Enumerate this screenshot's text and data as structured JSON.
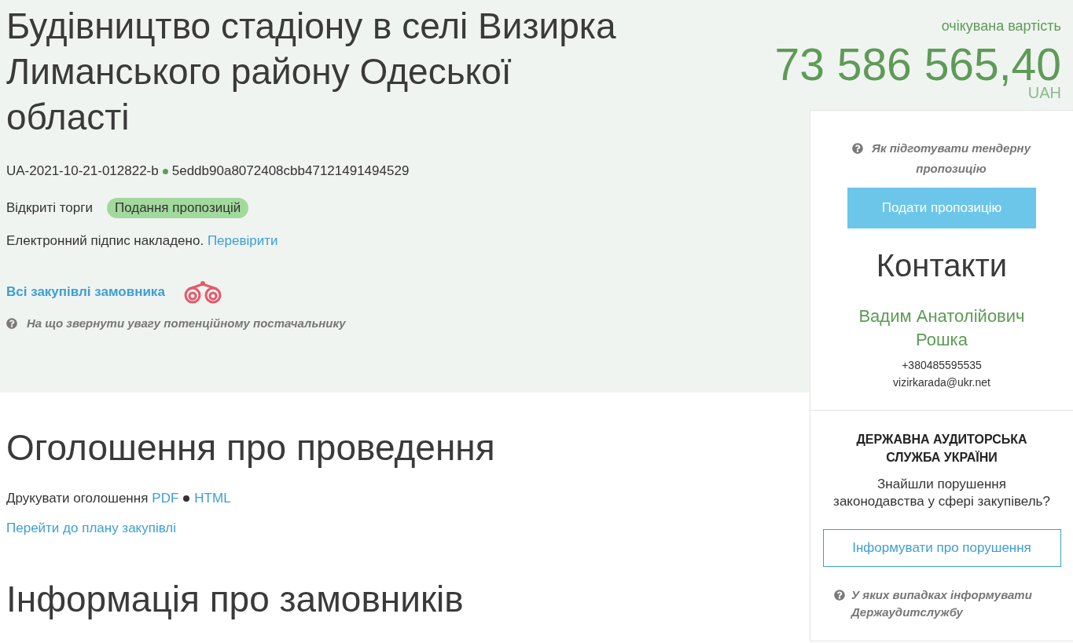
{
  "tender": {
    "title": "Будівництво стадіону в селі Визирка Лиманського району Одеської області",
    "id": "UA-2021-10-21-012822-b",
    "hash": "5eddb90a8072408cbb47121491494529",
    "procedure_type": "Відкриті торги",
    "status": "Подання пропозицій",
    "signature": {
      "text": "Електронний підпис накладено.",
      "link": "Перевірити"
    },
    "buyer_link": "Всі закупівлі замовника",
    "supplier_help": "На що звернути увагу потенційному постачальнику"
  },
  "price": {
    "label": "очікувана вартість",
    "amount": "73 586 565,40",
    "currency": "UAH"
  },
  "sidebar": {
    "proposal_help": "Як підготувати тендерну пропозицію",
    "submit_button": "Подати пропозицію",
    "contacts": {
      "heading": "Контакти",
      "name": "Вадим Анатолійович Рошка",
      "phone": "+380485595535",
      "email": "vizirkarada@ukr.net"
    },
    "audit": {
      "heading": "ДЕРЖАВНА АУДИТОРСЬКА СЛУЖБА УКРАЇНИ",
      "question": "Знайшли порушення\nзаконодавства у сфері закупівель?",
      "report_button": "Інформувати про порушення",
      "help": "У яких випадках інформувати Держаудитслужбу"
    }
  },
  "announcement": {
    "heading": "Оголошення про проведення",
    "print_label": "Друкувати оголошення",
    "print_formats": [
      "PDF",
      "HTML"
    ],
    "plan_link": "Перейти до плану закупівлі"
  },
  "customers": {
    "heading": "Інформація про замовників"
  }
}
